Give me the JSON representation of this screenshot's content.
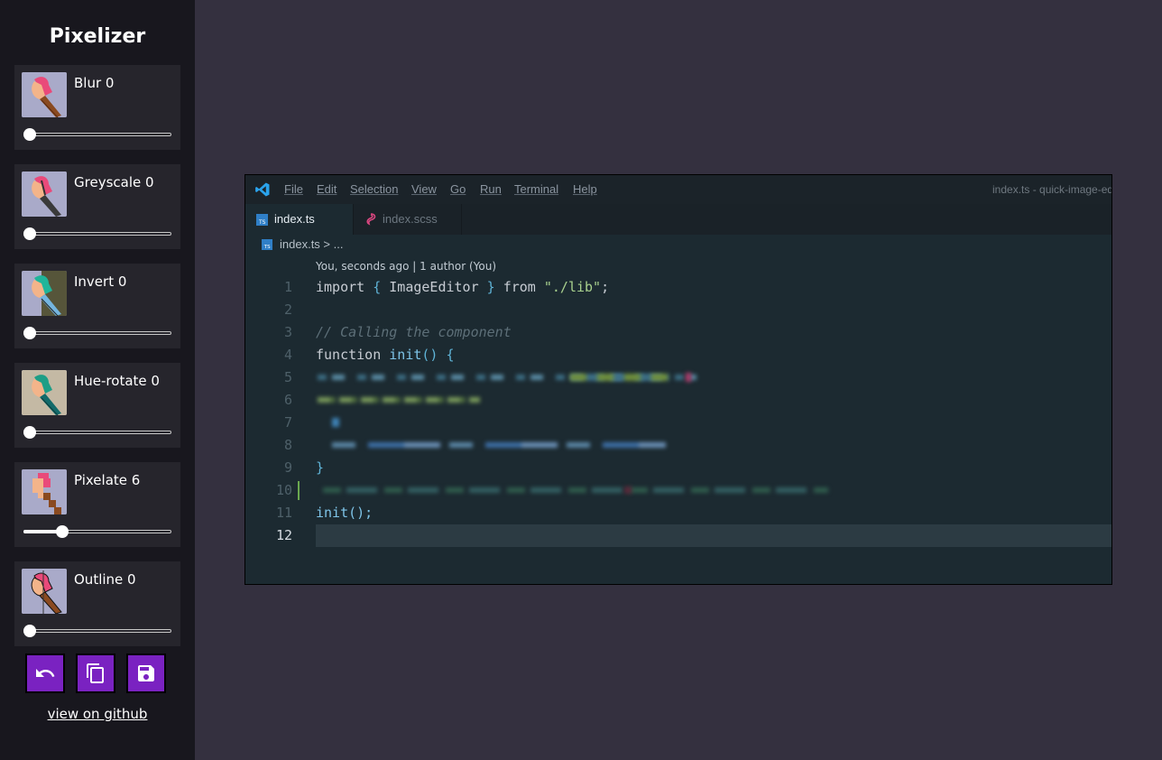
{
  "app": {
    "title": "Pixelizer"
  },
  "filters": [
    {
      "name": "Blur",
      "value": 0,
      "label": "Blur 0",
      "thumb_icon": "brush-icon",
      "level": 0
    },
    {
      "name": "Greyscale",
      "value": 0,
      "label": "Greyscale 0",
      "thumb_icon": "brush-icon",
      "level": 0
    },
    {
      "name": "Invert",
      "value": 0,
      "label": "Invert 0",
      "thumb_icon": "brush-icon",
      "level": 0
    },
    {
      "name": "Hue-rotate",
      "value": 0,
      "label": "Hue-rotate 0",
      "thumb_icon": "brush-icon",
      "level": 0
    },
    {
      "name": "Pixelate",
      "value": 6,
      "label": "Pixelate 6",
      "thumb_icon": "brush-icon",
      "level": 0.24
    },
    {
      "name": "Outline",
      "value": 0,
      "label": "Outline 0",
      "thumb_icon": "brush-icon",
      "level": 0
    }
  ],
  "actions": {
    "undo_icon": "undo-icon",
    "copy_icon": "copy-icon",
    "save_icon": "save-icon"
  },
  "github_link": "view on github",
  "colors": {
    "accent": "#7a22c1",
    "sidebar_bg": "#18171e",
    "card_bg": "#26252c",
    "page_bg": "#34303f"
  },
  "preview": {
    "menu": [
      "File",
      "Edit",
      "Selection",
      "View",
      "Go",
      "Run",
      "Terminal",
      "Help"
    ],
    "window_title": "index.ts - quick-image-ed",
    "tabs": [
      {
        "label": "index.ts",
        "icon": "typescript-file-icon",
        "active": true
      },
      {
        "label": "index.scss",
        "icon": "sass-file-icon",
        "active": false
      }
    ],
    "breadcrumb": "index.ts > ...",
    "blame": "You, seconds ago | 1 author (You)",
    "line_numbers": [
      "1",
      "2",
      "3",
      "4",
      "5",
      "6",
      "7",
      "8",
      "9",
      "10",
      "11",
      "12"
    ],
    "code": {
      "line1_kw": "import",
      "line1_brace_open": "{",
      "line1_name": "ImageEditor",
      "line1_brace_close": "}",
      "line1_from": "from",
      "line1_str": "\"./lib\"",
      "line1_end": ";",
      "line3": "// Calling the component",
      "line4_kw": "function",
      "line4_fn": "init",
      "line4_rest": "() {",
      "line9": "}",
      "line11": "init();"
    }
  }
}
